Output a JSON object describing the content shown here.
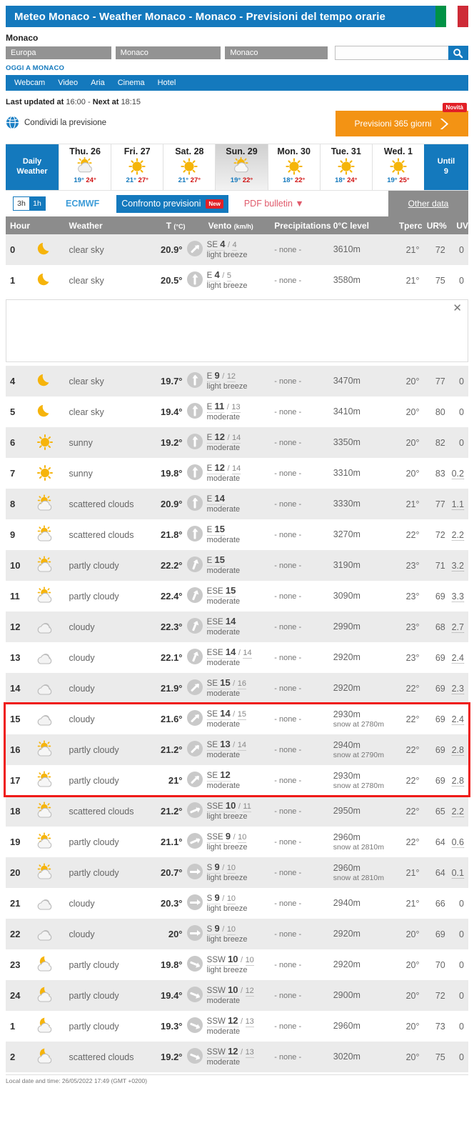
{
  "header": {
    "title": "Meteo Monaco - Weather Monaco - Monaco - Previsioni del tempo orarie",
    "flag_icon": "italian-flag-icon"
  },
  "location": {
    "name": "Monaco",
    "breadcrumbs": [
      "Europa",
      "Monaco",
      "Monaco"
    ],
    "search_value": "",
    "search_placeholder": "",
    "search_icon": "search-icon",
    "today_link": "OGGI A MONACO"
  },
  "nav": {
    "items": [
      "Webcam",
      "Video",
      "Aria",
      "Cinema",
      "Hotel"
    ]
  },
  "update": {
    "prefix": "Last updated at",
    "last": "16:00",
    "separator": "-",
    "next_prefix": "Next at",
    "next": "18:15",
    "share_label": "Condividi la previsione",
    "share_icon": "globe-share-icon"
  },
  "promo": {
    "label": "Previsioni 365 giorni",
    "badge": "Novità",
    "arrow_icon": "chevron-right-icon"
  },
  "days": {
    "first_label_line1": "Daily",
    "first_label_line2": "Weather",
    "last_label_line1": "Until",
    "last_label_line2": "9",
    "items": [
      {
        "label": "Thu. 26",
        "icon": "sun-cloud-rain-icon",
        "tmin": "19°",
        "tmax": "24°",
        "active": false
      },
      {
        "label": "Fri. 27",
        "icon": "sun-icon",
        "tmin": "21°",
        "tmax": "27°",
        "active": false
      },
      {
        "label": "Sat. 28",
        "icon": "sun-icon",
        "tmin": "21°",
        "tmax": "27°",
        "active": false
      },
      {
        "label": "Sun. 29",
        "icon": "sun-cloud-rain-icon",
        "tmin": "19°",
        "tmax": "22°",
        "active": true
      },
      {
        "label": "Mon. 30",
        "icon": "sun-icon",
        "tmin": "18°",
        "tmax": "22°",
        "active": false
      },
      {
        "label": "Tue. 31",
        "icon": "sun-icon",
        "tmin": "18°",
        "tmax": "24°",
        "active": false
      },
      {
        "label": "Wed. 1",
        "icon": "sun-icon",
        "tmin": "19°",
        "tmax": "25°",
        "active": false
      }
    ]
  },
  "toolbar": {
    "interval_3h": "3h",
    "interval_1h": "1h",
    "interval_selected": "1h",
    "model": "ECMWF",
    "compare_label": "Confronto previsioni",
    "compare_badge": "New",
    "pdf_label": "PDF bulletin",
    "pdf_caret_icon": "caret-down-icon",
    "other_data": "Other data"
  },
  "table": {
    "headers": {
      "hour": "Hour",
      "weather": "Weather",
      "temp": "T",
      "temp_unit": "(°C)",
      "wind": "Vento",
      "wind_unit": "(km/h)",
      "precipitations": "Precipitations",
      "zero_level": "0°C level",
      "tperc": "Tperc",
      "ur": "UR%",
      "uv": "UV"
    },
    "ad_close_icon": "close-icon",
    "rows": [
      {
        "hour": "0",
        "icon": "moon-icon",
        "weather": "clear sky",
        "temp": "20.9°",
        "wind_dir": "SE",
        "wind_speed": "4",
        "wind_gust": "4",
        "wind_desc": "light breeze",
        "wind_angle": 315,
        "prec": "- none -",
        "zero": "3610m",
        "snow": "",
        "tperc": "21°",
        "ur": "72",
        "uv": "0"
      },
      {
        "hour": "1",
        "icon": "moon-icon",
        "weather": "clear sky",
        "temp": "20.5°",
        "wind_dir": "E",
        "wind_speed": "4",
        "wind_gust": "5",
        "wind_desc": "light breeze",
        "wind_angle": 270,
        "prec": "- none -",
        "zero": "3580m",
        "snow": "",
        "tperc": "21°",
        "ur": "75",
        "uv": "0"
      },
      {
        "hour": "4",
        "icon": "moon-icon",
        "weather": "clear sky",
        "temp": "19.7°",
        "wind_dir": "E",
        "wind_speed": "9",
        "wind_gust": "12",
        "wind_desc": "light breeze",
        "wind_angle": 270,
        "prec": "- none -",
        "zero": "3470m",
        "snow": "",
        "tperc": "20°",
        "ur": "77",
        "uv": "0"
      },
      {
        "hour": "5",
        "icon": "moon-icon",
        "weather": "clear sky",
        "temp": "19.4°",
        "wind_dir": "E",
        "wind_speed": "11",
        "wind_gust": "13",
        "wind_desc": "moderate",
        "wind_angle": 270,
        "prec": "- none -",
        "zero": "3410m",
        "snow": "",
        "tperc": "20°",
        "ur": "80",
        "uv": "0"
      },
      {
        "hour": "6",
        "icon": "sun-icon",
        "weather": "sunny",
        "temp": "19.2°",
        "wind_dir": "E",
        "wind_speed": "12",
        "wind_gust": "14",
        "wind_desc": "moderate",
        "wind_angle": 270,
        "prec": "- none -",
        "zero": "3350m",
        "snow": "",
        "tperc": "20°",
        "ur": "82",
        "uv": "0"
      },
      {
        "hour": "7",
        "icon": "sun-icon",
        "weather": "sunny",
        "temp": "19.8°",
        "wind_dir": "E",
        "wind_speed": "12",
        "wind_gust": "14",
        "wind_desc": "moderate",
        "wind_angle": 270,
        "prec": "- none -",
        "zero": "3310m",
        "snow": "",
        "tperc": "20°",
        "ur": "83",
        "uv": "0.2"
      },
      {
        "hour": "8",
        "icon": "sun-cloud-icon",
        "weather": "scattered clouds",
        "temp": "20.9°",
        "wind_dir": "E",
        "wind_speed": "14",
        "wind_gust": "",
        "wind_desc": "moderate",
        "wind_angle": 270,
        "prec": "- none -",
        "zero": "3330m",
        "snow": "",
        "tperc": "21°",
        "ur": "77",
        "uv": "1.1"
      },
      {
        "hour": "9",
        "icon": "sun-cloud-icon",
        "weather": "scattered clouds",
        "temp": "21.8°",
        "wind_dir": "E",
        "wind_speed": "15",
        "wind_gust": "",
        "wind_desc": "moderate",
        "wind_angle": 270,
        "prec": "- none -",
        "zero": "3270m",
        "snow": "",
        "tperc": "22°",
        "ur": "72",
        "uv": "2.2"
      },
      {
        "hour": "10",
        "icon": "sun-cloud-icon",
        "weather": "partly cloudy",
        "temp": "22.2°",
        "wind_dir": "E",
        "wind_speed": "15",
        "wind_gust": "",
        "wind_desc": "moderate",
        "wind_angle": 290,
        "prec": "- none -",
        "zero": "3190m",
        "snow": "",
        "tperc": "23°",
        "ur": "71",
        "uv": "3.2"
      },
      {
        "hour": "11",
        "icon": "sun-cloud-icon",
        "weather": "partly cloudy",
        "temp": "22.4°",
        "wind_dir": "ESE",
        "wind_speed": "15",
        "wind_gust": "",
        "wind_desc": "moderate",
        "wind_angle": 292,
        "prec": "- none -",
        "zero": "3090m",
        "snow": "",
        "tperc": "23°",
        "ur": "69",
        "uv": "3.3"
      },
      {
        "hour": "12",
        "icon": "cloud-icon",
        "weather": "cloudy",
        "temp": "22.3°",
        "wind_dir": "ESE",
        "wind_speed": "14",
        "wind_gust": "",
        "wind_desc": "moderate",
        "wind_angle": 292,
        "prec": "- none -",
        "zero": "2990m",
        "snow": "",
        "tperc": "23°",
        "ur": "68",
        "uv": "2.7"
      },
      {
        "hour": "13",
        "icon": "cloud-icon",
        "weather": "cloudy",
        "temp": "22.1°",
        "wind_dir": "ESE",
        "wind_speed": "14",
        "wind_gust": "14",
        "wind_desc": "moderate",
        "wind_angle": 292,
        "prec": "- none -",
        "zero": "2920m",
        "snow": "",
        "tperc": "23°",
        "ur": "69",
        "uv": "2.4"
      },
      {
        "hour": "14",
        "icon": "cloud-icon",
        "weather": "cloudy",
        "temp": "21.9°",
        "wind_dir": "SE",
        "wind_speed": "15",
        "wind_gust": "16",
        "wind_desc": "moderate",
        "wind_angle": 315,
        "prec": "- none -",
        "zero": "2920m",
        "snow": "",
        "tperc": "22°",
        "ur": "69",
        "uv": "2.3"
      },
      {
        "hour": "15",
        "icon": "cloud-icon",
        "weather": "cloudy",
        "temp": "21.6°",
        "wind_dir": "SE",
        "wind_speed": "14",
        "wind_gust": "15",
        "wind_desc": "moderate",
        "wind_angle": 315,
        "prec": "- none -",
        "zero": "2930m",
        "snow": "snow at 2780m",
        "tperc": "22°",
        "ur": "69",
        "uv": "2.4"
      },
      {
        "hour": "16",
        "icon": "sun-cloud-icon",
        "weather": "partly cloudy",
        "temp": "21.2°",
        "wind_dir": "SE",
        "wind_speed": "13",
        "wind_gust": "14",
        "wind_desc": "moderate",
        "wind_angle": 315,
        "prec": "- none -",
        "zero": "2940m",
        "snow": "snow at 2790m",
        "tperc": "22°",
        "ur": "69",
        "uv": "2.8"
      },
      {
        "hour": "17",
        "icon": "sun-cloud-icon",
        "weather": "partly cloudy",
        "temp": "21°",
        "wind_dir": "SE",
        "wind_speed": "12",
        "wind_gust": "",
        "wind_desc": "moderate",
        "wind_angle": 315,
        "prec": "- none -",
        "zero": "2930m",
        "snow": "snow at 2780m",
        "tperc": "22°",
        "ur": "69",
        "uv": "2.8"
      },
      {
        "hour": "18",
        "icon": "sun-cloud-icon",
        "weather": "scattered clouds",
        "temp": "21.2°",
        "wind_dir": "SSE",
        "wind_speed": "10",
        "wind_gust": "11",
        "wind_desc": "light breeze",
        "wind_angle": 337,
        "prec": "- none -",
        "zero": "2950m",
        "snow": "",
        "tperc": "22°",
        "ur": "65",
        "uv": "2.2"
      },
      {
        "hour": "19",
        "icon": "sun-cloud-icon",
        "weather": "partly cloudy",
        "temp": "21.1°",
        "wind_dir": "SSE",
        "wind_speed": "9",
        "wind_gust": "10",
        "wind_desc": "light breeze",
        "wind_angle": 337,
        "prec": "- none -",
        "zero": "2960m",
        "snow": "snow at 2810m",
        "tperc": "22°",
        "ur": "64",
        "uv": "0.6"
      },
      {
        "hour": "20",
        "icon": "sun-cloud-icon",
        "weather": "partly cloudy",
        "temp": "20.7°",
        "wind_dir": "S",
        "wind_speed": "9",
        "wind_gust": "10",
        "wind_desc": "light breeze",
        "wind_angle": 0,
        "prec": "- none -",
        "zero": "2960m",
        "snow": "snow at 2810m",
        "tperc": "21°",
        "ur": "64",
        "uv": "0.1"
      },
      {
        "hour": "21",
        "icon": "cloud-icon",
        "weather": "cloudy",
        "temp": "20.3°",
        "wind_dir": "S",
        "wind_speed": "9",
        "wind_gust": "10",
        "wind_desc": "light breeze",
        "wind_angle": 0,
        "prec": "- none -",
        "zero": "2940m",
        "snow": "",
        "tperc": "21°",
        "ur": "66",
        "uv": "0"
      },
      {
        "hour": "22",
        "icon": "cloud-icon",
        "weather": "cloudy",
        "temp": "20°",
        "wind_dir": "S",
        "wind_speed": "9",
        "wind_gust": "10",
        "wind_desc": "light breeze",
        "wind_angle": 0,
        "prec": "- none -",
        "zero": "2920m",
        "snow": "",
        "tperc": "20°",
        "ur": "69",
        "uv": "0"
      },
      {
        "hour": "23",
        "icon": "moon-cloud-icon",
        "weather": "partly cloudy",
        "temp": "19.8°",
        "wind_dir": "SSW",
        "wind_speed": "10",
        "wind_gust": "10",
        "wind_desc": "light breeze",
        "wind_angle": 22,
        "prec": "- none -",
        "zero": "2920m",
        "snow": "",
        "tperc": "20°",
        "ur": "70",
        "uv": "0"
      },
      {
        "hour": "24",
        "icon": "moon-cloud-icon",
        "weather": "partly cloudy",
        "temp": "19.4°",
        "wind_dir": "SSW",
        "wind_speed": "10",
        "wind_gust": "12",
        "wind_desc": "moderate",
        "wind_angle": 22,
        "prec": "- none -",
        "zero": "2900m",
        "snow": "",
        "tperc": "20°",
        "ur": "72",
        "uv": "0"
      },
      {
        "hour": "1",
        "icon": "moon-cloud-icon",
        "weather": "partly cloudy",
        "temp": "19.3°",
        "wind_dir": "SSW",
        "wind_speed": "12",
        "wind_gust": "13",
        "wind_desc": "moderate",
        "wind_angle": 22,
        "prec": "- none -",
        "zero": "2960m",
        "snow": "",
        "tperc": "20°",
        "ur": "73",
        "uv": "0"
      },
      {
        "hour": "2",
        "icon": "moon-cloud-icon",
        "weather": "scattered clouds",
        "temp": "19.2°",
        "wind_dir": "SSW",
        "wind_speed": "12",
        "wind_gust": "13",
        "wind_desc": "moderate",
        "wind_angle": 22,
        "prec": "- none -",
        "zero": "3020m",
        "snow": "",
        "tperc": "20°",
        "ur": "75",
        "uv": "0"
      }
    ],
    "ad_after_row_index": 1,
    "highlight_rows": [
      "15",
      "16",
      "17"
    ]
  },
  "footer": {
    "text": "Local date and time: 26/05/2022 17:49 (GMT +0200)"
  },
  "colors": {
    "brand_blue": "#1479bd",
    "promo_orange": "#f39314",
    "badge_red": "#e21f26",
    "highlight_red": "#ef1b18",
    "header_gray": "#8c8c8c"
  }
}
